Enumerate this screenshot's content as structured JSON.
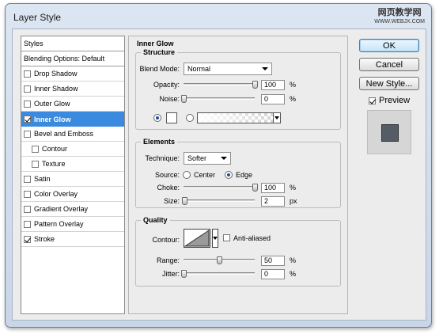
{
  "window": {
    "title": "Layer Style",
    "watermark_cn": "网页教学网",
    "watermark_url": "WWW.WEBJX.COM"
  },
  "left_panel": {
    "items": [
      {
        "label": "Styles",
        "checkbox": false,
        "checked": false
      },
      {
        "label": "Blending Options: Default",
        "checkbox": false,
        "checked": false
      },
      {
        "label": "Drop Shadow",
        "checkbox": true,
        "checked": false
      },
      {
        "label": "Inner Shadow",
        "checkbox": true,
        "checked": false
      },
      {
        "label": "Outer Glow",
        "checkbox": true,
        "checked": false
      },
      {
        "label": "Inner Glow",
        "checkbox": true,
        "checked": true,
        "selected": true
      },
      {
        "label": "Bevel and Emboss",
        "checkbox": true,
        "checked": false
      },
      {
        "label": "Contour",
        "checkbox": true,
        "checked": false,
        "indent": true
      },
      {
        "label": "Texture",
        "checkbox": true,
        "checked": false,
        "indent": true
      },
      {
        "label": "Satin",
        "checkbox": true,
        "checked": false
      },
      {
        "label": "Color Overlay",
        "checkbox": true,
        "checked": false
      },
      {
        "label": "Gradient Overlay",
        "checkbox": true,
        "checked": false
      },
      {
        "label": "Pattern Overlay",
        "checkbox": true,
        "checked": false
      },
      {
        "label": "Stroke",
        "checkbox": true,
        "checked": true
      }
    ]
  },
  "inner_glow": {
    "heading": "Inner Glow",
    "structure": {
      "title": "Structure",
      "blend_mode_label": "Blend Mode:",
      "blend_mode_value": "Normal",
      "opacity_label": "Opacity:",
      "opacity_value": "100",
      "opacity_fraction": 1.0,
      "opacity_unit": "%",
      "noise_label": "Noise:",
      "noise_value": "0",
      "noise_fraction": 0.0,
      "noise_unit": "%",
      "color_mode": "solid",
      "swatch_color": "#ffffff"
    },
    "elements": {
      "title": "Elements",
      "technique_label": "Technique:",
      "technique_value": "Softer",
      "source_label": "Source:",
      "source_center": "Center",
      "source_edge": "Edge",
      "source_selected": "edge",
      "choke_label": "Choke:",
      "choke_value": "100",
      "choke_fraction": 1.0,
      "choke_unit": "%",
      "size_label": "Size:",
      "size_value": "2",
      "size_fraction": 0.01,
      "size_unit": "px"
    },
    "quality": {
      "title": "Quality",
      "contour_label": "Contour:",
      "anti_aliased_label": "Anti-aliased",
      "anti_aliased_checked": false,
      "range_label": "Range:",
      "range_value": "50",
      "range_fraction": 0.5,
      "range_unit": "%",
      "jitter_label": "Jitter:",
      "jitter_value": "0",
      "jitter_fraction": 0.0,
      "jitter_unit": "%"
    }
  },
  "buttons": {
    "ok": "OK",
    "cancel": "Cancel",
    "new_style": "New Style...",
    "preview_label": "Preview",
    "preview_checked": true
  },
  "colors": {
    "selection": "#3a8ae0",
    "preview_square": "#555c66"
  }
}
